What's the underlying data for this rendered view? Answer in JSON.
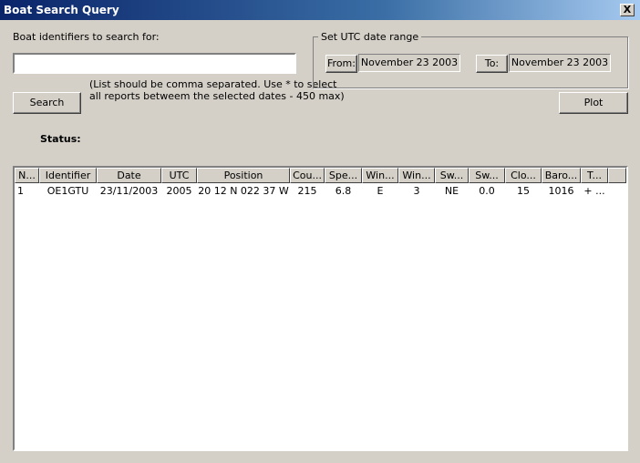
{
  "window": {
    "title": "Boat Search Query",
    "close_label": "X"
  },
  "search": {
    "label": "Boat identifiers to search for:",
    "value": "",
    "hint_line1": "(List should be comma separated. Use * to select",
    "hint_line2": "all reports betweem the selected dates - 450 max)",
    "button_label": "Search"
  },
  "date_range": {
    "group_label": "Set UTC date range",
    "from_label": "From:",
    "from_value": "November 23 2003",
    "to_label": "To:",
    "to_value": "November 23 2003"
  },
  "plot_label": "Plot",
  "status_label": "Status:",
  "table": {
    "columns": [
      "N...",
      "Identifier",
      "Date",
      "UTC",
      "Position",
      "Cou...",
      "Spe...",
      "Win...",
      "Win...",
      "Sw...",
      "Sw...",
      "Clo...",
      "Baro...",
      "T..."
    ],
    "rows": [
      [
        "1",
        "OE1GTU",
        "23/11/2003",
        "2005",
        "20 12 N 022 37 W",
        "215",
        "6.8",
        "E",
        "3",
        "NE",
        "0.0",
        "15",
        "1016",
        "+ ..."
      ]
    ]
  }
}
